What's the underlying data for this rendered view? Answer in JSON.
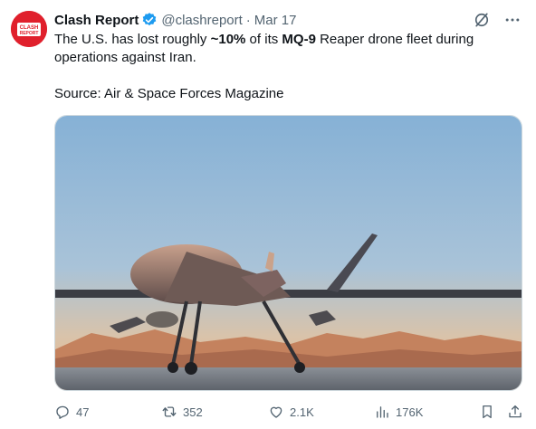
{
  "tweet": {
    "author": {
      "name": "Clash Report",
      "handle": "@clashreport",
      "avatar_text_line1": "CLASH",
      "avatar_text_line2": "REPORT",
      "verified": true
    },
    "separator": "·",
    "date": "Mar 17",
    "body": {
      "line1_pre": "The U.S. has lost roughly ",
      "line1_bold1": "~10%",
      "line1_mid": " of its ",
      "line1_bold2": "MQ-9",
      "line1_post": " Reaper drone fleet during",
      "line2": "operations against Iran.",
      "source": "Source: Air & Space Forces Magazine"
    },
    "media": {
      "icon": "image"
    },
    "actions": {
      "replies": "47",
      "reposts": "352",
      "likes": "2.1K",
      "views": "176K"
    }
  },
  "colors": {
    "accent": "#1d9bf0",
    "muted": "#536471",
    "avatar_bg": "#e0202c",
    "sky_top": "#8db6d8",
    "sky_bottom": "#e6b48c"
  },
  "icons": [
    "verified-badge-icon",
    "grok-icon",
    "more-icon",
    "reply-icon",
    "repost-icon",
    "like-icon",
    "views-icon",
    "bookmark-icon",
    "share-icon"
  ]
}
